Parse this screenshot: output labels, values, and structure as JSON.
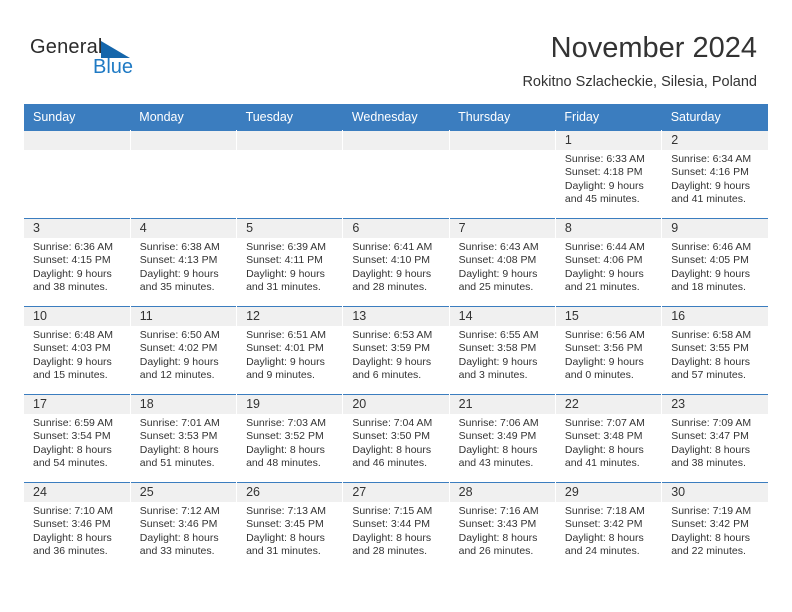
{
  "brand": {
    "name_line1": "General",
    "name_line2": "Blue",
    "triangle_icon": "triangle-icon",
    "accent_dark": "#1566ab",
    "accent_light": "#1f7ac4"
  },
  "header": {
    "title": "November 2024",
    "location": "Rokitno Szlacheckie, Silesia, Poland"
  },
  "theme": {
    "header_bg": "#3b7dbf",
    "daynum_bg": "#f0f0f0",
    "text": "#333333"
  },
  "calendar": {
    "weekdays": [
      "Sunday",
      "Monday",
      "Tuesday",
      "Wednesday",
      "Thursday",
      "Friday",
      "Saturday"
    ],
    "weeks": [
      [
        {
          "day": "",
          "empty": true
        },
        {
          "day": "",
          "empty": true
        },
        {
          "day": "",
          "empty": true
        },
        {
          "day": "",
          "empty": true
        },
        {
          "day": "",
          "empty": true
        },
        {
          "day": "1",
          "sunrise": "Sunrise: 6:33 AM",
          "sunset": "Sunset: 4:18 PM",
          "daylight1": "Daylight: 9 hours",
          "daylight2": "and 45 minutes."
        },
        {
          "day": "2",
          "sunrise": "Sunrise: 6:34 AM",
          "sunset": "Sunset: 4:16 PM",
          "daylight1": "Daylight: 9 hours",
          "daylight2": "and 41 minutes."
        }
      ],
      [
        {
          "day": "3",
          "sunrise": "Sunrise: 6:36 AM",
          "sunset": "Sunset: 4:15 PM",
          "daylight1": "Daylight: 9 hours",
          "daylight2": "and 38 minutes."
        },
        {
          "day": "4",
          "sunrise": "Sunrise: 6:38 AM",
          "sunset": "Sunset: 4:13 PM",
          "daylight1": "Daylight: 9 hours",
          "daylight2": "and 35 minutes."
        },
        {
          "day": "5",
          "sunrise": "Sunrise: 6:39 AM",
          "sunset": "Sunset: 4:11 PM",
          "daylight1": "Daylight: 9 hours",
          "daylight2": "and 31 minutes."
        },
        {
          "day": "6",
          "sunrise": "Sunrise: 6:41 AM",
          "sunset": "Sunset: 4:10 PM",
          "daylight1": "Daylight: 9 hours",
          "daylight2": "and 28 minutes."
        },
        {
          "day": "7",
          "sunrise": "Sunrise: 6:43 AM",
          "sunset": "Sunset: 4:08 PM",
          "daylight1": "Daylight: 9 hours",
          "daylight2": "and 25 minutes."
        },
        {
          "day": "8",
          "sunrise": "Sunrise: 6:44 AM",
          "sunset": "Sunset: 4:06 PM",
          "daylight1": "Daylight: 9 hours",
          "daylight2": "and 21 minutes."
        },
        {
          "day": "9",
          "sunrise": "Sunrise: 6:46 AM",
          "sunset": "Sunset: 4:05 PM",
          "daylight1": "Daylight: 9 hours",
          "daylight2": "and 18 minutes."
        }
      ],
      [
        {
          "day": "10",
          "sunrise": "Sunrise: 6:48 AM",
          "sunset": "Sunset: 4:03 PM",
          "daylight1": "Daylight: 9 hours",
          "daylight2": "and 15 minutes."
        },
        {
          "day": "11",
          "sunrise": "Sunrise: 6:50 AM",
          "sunset": "Sunset: 4:02 PM",
          "daylight1": "Daylight: 9 hours",
          "daylight2": "and 12 minutes."
        },
        {
          "day": "12",
          "sunrise": "Sunrise: 6:51 AM",
          "sunset": "Sunset: 4:01 PM",
          "daylight1": "Daylight: 9 hours",
          "daylight2": "and 9 minutes."
        },
        {
          "day": "13",
          "sunrise": "Sunrise: 6:53 AM",
          "sunset": "Sunset: 3:59 PM",
          "daylight1": "Daylight: 9 hours",
          "daylight2": "and 6 minutes."
        },
        {
          "day": "14",
          "sunrise": "Sunrise: 6:55 AM",
          "sunset": "Sunset: 3:58 PM",
          "daylight1": "Daylight: 9 hours",
          "daylight2": "and 3 minutes."
        },
        {
          "day": "15",
          "sunrise": "Sunrise: 6:56 AM",
          "sunset": "Sunset: 3:56 PM",
          "daylight1": "Daylight: 9 hours",
          "daylight2": "and 0 minutes."
        },
        {
          "day": "16",
          "sunrise": "Sunrise: 6:58 AM",
          "sunset": "Sunset: 3:55 PM",
          "daylight1": "Daylight: 8 hours",
          "daylight2": "and 57 minutes."
        }
      ],
      [
        {
          "day": "17",
          "sunrise": "Sunrise: 6:59 AM",
          "sunset": "Sunset: 3:54 PM",
          "daylight1": "Daylight: 8 hours",
          "daylight2": "and 54 minutes."
        },
        {
          "day": "18",
          "sunrise": "Sunrise: 7:01 AM",
          "sunset": "Sunset: 3:53 PM",
          "daylight1": "Daylight: 8 hours",
          "daylight2": "and 51 minutes."
        },
        {
          "day": "19",
          "sunrise": "Sunrise: 7:03 AM",
          "sunset": "Sunset: 3:52 PM",
          "daylight1": "Daylight: 8 hours",
          "daylight2": "and 48 minutes."
        },
        {
          "day": "20",
          "sunrise": "Sunrise: 7:04 AM",
          "sunset": "Sunset: 3:50 PM",
          "daylight1": "Daylight: 8 hours",
          "daylight2": "and 46 minutes."
        },
        {
          "day": "21",
          "sunrise": "Sunrise: 7:06 AM",
          "sunset": "Sunset: 3:49 PM",
          "daylight1": "Daylight: 8 hours",
          "daylight2": "and 43 minutes."
        },
        {
          "day": "22",
          "sunrise": "Sunrise: 7:07 AM",
          "sunset": "Sunset: 3:48 PM",
          "daylight1": "Daylight: 8 hours",
          "daylight2": "and 41 minutes."
        },
        {
          "day": "23",
          "sunrise": "Sunrise: 7:09 AM",
          "sunset": "Sunset: 3:47 PM",
          "daylight1": "Daylight: 8 hours",
          "daylight2": "and 38 minutes."
        }
      ],
      [
        {
          "day": "24",
          "sunrise": "Sunrise: 7:10 AM",
          "sunset": "Sunset: 3:46 PM",
          "daylight1": "Daylight: 8 hours",
          "daylight2": "and 36 minutes."
        },
        {
          "day": "25",
          "sunrise": "Sunrise: 7:12 AM",
          "sunset": "Sunset: 3:46 PM",
          "daylight1": "Daylight: 8 hours",
          "daylight2": "and 33 minutes."
        },
        {
          "day": "26",
          "sunrise": "Sunrise: 7:13 AM",
          "sunset": "Sunset: 3:45 PM",
          "daylight1": "Daylight: 8 hours",
          "daylight2": "and 31 minutes."
        },
        {
          "day": "27",
          "sunrise": "Sunrise: 7:15 AM",
          "sunset": "Sunset: 3:44 PM",
          "daylight1": "Daylight: 8 hours",
          "daylight2": "and 28 minutes."
        },
        {
          "day": "28",
          "sunrise": "Sunrise: 7:16 AM",
          "sunset": "Sunset: 3:43 PM",
          "daylight1": "Daylight: 8 hours",
          "daylight2": "and 26 minutes."
        },
        {
          "day": "29",
          "sunrise": "Sunrise: 7:18 AM",
          "sunset": "Sunset: 3:42 PM",
          "daylight1": "Daylight: 8 hours",
          "daylight2": "and 24 minutes."
        },
        {
          "day": "30",
          "sunrise": "Sunrise: 7:19 AM",
          "sunset": "Sunset: 3:42 PM",
          "daylight1": "Daylight: 8 hours",
          "daylight2": "and 22 minutes."
        }
      ]
    ]
  }
}
